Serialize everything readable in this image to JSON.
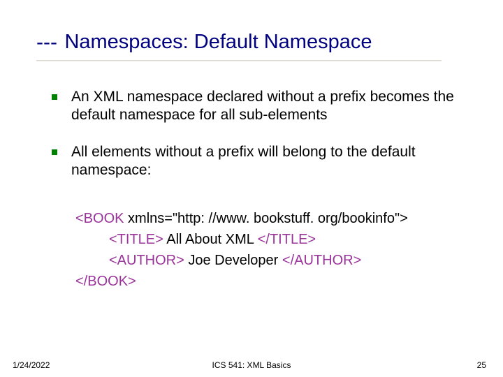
{
  "title": {
    "prefix": "---",
    "text": "Namespaces: Default Namespace"
  },
  "bullets": [
    "An XML namespace declared without a prefix becomes the default namespace for all sub-elements",
    "All elements without a prefix will belong to the default namespace:"
  ],
  "code": {
    "line1_tag": "<BOOK",
    "line1_rest": " xmlns=\"http: //www. bookstuff. org/bookinfo\">",
    "line2_tag_open": "<TITLE>",
    "line2_text": " All About XML ",
    "line2_tag_close": "</TITLE>",
    "line3_tag_open": "<AUTHOR>",
    "line3_text": " Joe Developer ",
    "line3_tag_close": "</AUTHOR>",
    "line4_tag": "</BOOK>"
  },
  "footer": {
    "date": "1/24/2022",
    "center": "ICS 541: XML Basics",
    "page": "25"
  }
}
